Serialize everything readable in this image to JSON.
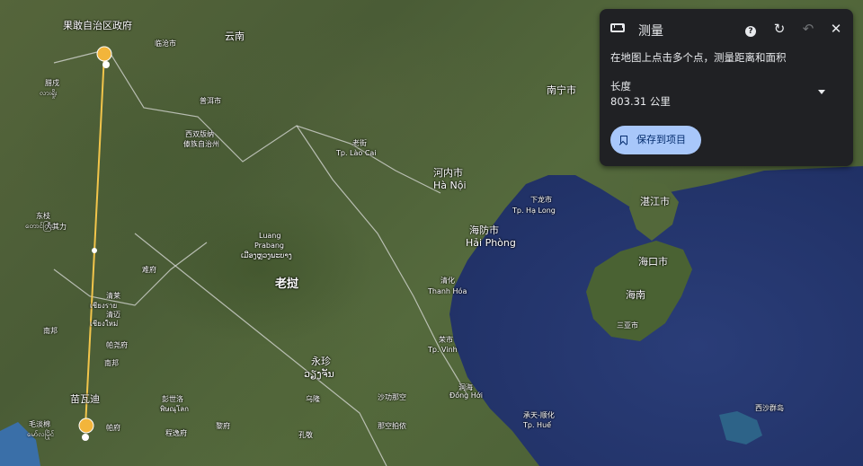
{
  "map": {
    "country_labels": [
      {
        "text": "老挝"
      }
    ],
    "place_labels": [
      {
        "id": "kokang",
        "text": "果敢自治区政府"
      },
      {
        "id": "yunnan",
        "text": "云南"
      },
      {
        "id": "nanning",
        "text": "南宁市"
      },
      {
        "id": "laocai_cn",
        "text": "老街"
      },
      {
        "id": "laocai",
        "text": "Tp. Lào Cai"
      },
      {
        "id": "hanoi_cn",
        "text": "河内市"
      },
      {
        "id": "hanoi",
        "text": "Hà Nội"
      },
      {
        "id": "halong_cn",
        "text": "下龙市"
      },
      {
        "id": "halong",
        "text": "Tp. Hạ Long"
      },
      {
        "id": "zhanjiang",
        "text": "湛江市"
      },
      {
        "id": "haiphong_cn",
        "text": "海防市"
      },
      {
        "id": "haiphong",
        "text": "Hải Phòng"
      },
      {
        "id": "haikou",
        "text": "海口市"
      },
      {
        "id": "hainan",
        "text": "海南"
      },
      {
        "id": "sanya",
        "text": "三亚市"
      },
      {
        "id": "luang_cn",
        "text": "Luang"
      },
      {
        "id": "prabang",
        "text": "Prabang"
      },
      {
        "id": "prabang_lo",
        "text": "ເມືອງຫຼວງພະບາງ"
      },
      {
        "id": "thanhhoa_cn",
        "text": "清化"
      },
      {
        "id": "thanhhoa",
        "text": "Thanh Hóa"
      },
      {
        "id": "vinh_cn",
        "text": "荣市"
      },
      {
        "id": "vinh",
        "text": "Tp. Vinh"
      },
      {
        "id": "vientiane_cn",
        "text": "永珍"
      },
      {
        "id": "vientiane_lo",
        "text": "ວຽງຈັນ"
      },
      {
        "id": "donghoi_cn",
        "text": "洞海"
      },
      {
        "id": "donghoi",
        "text": "Đồng Hới"
      },
      {
        "id": "hue_cn",
        "text": "承天-顺化"
      },
      {
        "id": "hue",
        "text": "Tp. Huế"
      },
      {
        "id": "xisha",
        "text": "西沙群岛"
      },
      {
        "id": "chiangrai_cn",
        "text": "清莱"
      },
      {
        "id": "chiangrai",
        "text": "เชียงราย"
      },
      {
        "id": "chiangmai_cn",
        "text": "清迈"
      },
      {
        "id": "chiangmai",
        "text": "เชียงใหม่"
      },
      {
        "id": "tachileik_cn",
        "text": "大其力"
      },
      {
        "id": "lampang_cn",
        "text": "南邦"
      },
      {
        "id": "phitsanulok_cn",
        "text": "彭世洛"
      },
      {
        "id": "phitsanulok",
        "text": "พิษณุโลก"
      },
      {
        "id": "myawaddy",
        "text": "苗瓦迪"
      },
      {
        "id": "mawlamyine_cn",
        "text": "毛淡棉"
      },
      {
        "id": "mawlamyine",
        "text": "မော်လမြိုင်"
      },
      {
        "id": "lashio_cn",
        "text": "腊戍"
      },
      {
        "id": "lashio",
        "text": "လားရှိုး"
      },
      {
        "id": "taunggyi_cn",
        "text": "东枝"
      },
      {
        "id": "taunggyi",
        "text": "တောင်ကြီး"
      },
      {
        "id": "xishuangbanna_cn",
        "text": "西双版纳"
      },
      {
        "id": "xishuangbanna",
        "text": "傣族自治州"
      },
      {
        "id": "puer",
        "text": "普洱市"
      },
      {
        "id": "lincang",
        "text": "临沧市"
      },
      {
        "id": "lampang",
        "text": "南邦"
      },
      {
        "id": "nan",
        "text": "难府"
      },
      {
        "id": "phrae",
        "text": "帕府"
      },
      {
        "id": "uttaradit",
        "text": "程逸府"
      },
      {
        "id": "phayao",
        "text": "帕尧府"
      },
      {
        "id": "sakon",
        "text": "沙功那空"
      },
      {
        "id": "nakhon",
        "text": "那空拍侬"
      },
      {
        "id": "udon",
        "text": "乌隆"
      },
      {
        "id": "khon",
        "text": "孔敬"
      },
      {
        "id": "loei",
        "text": "黎府"
      }
    ]
  },
  "measure_panel": {
    "title": "测量",
    "instruction": "在地图上点击多个点，测量距离和面积",
    "length_label": "长度",
    "length_value": "803.31 公里",
    "save_label": "保存到项目",
    "help_glyph": "?",
    "refresh_glyph": "↻",
    "undo_glyph": "↶",
    "close_glyph": "✕"
  },
  "measurement": {
    "color": "#f2c54b",
    "points": [
      {
        "name": "start",
        "lat": 23.3,
        "lng": 98.2
      },
      {
        "name": "mid",
        "lat": 19.1,
        "lng": 97.9
      },
      {
        "name": "end",
        "lat": 16.2,
        "lng": 97.6
      }
    ]
  }
}
